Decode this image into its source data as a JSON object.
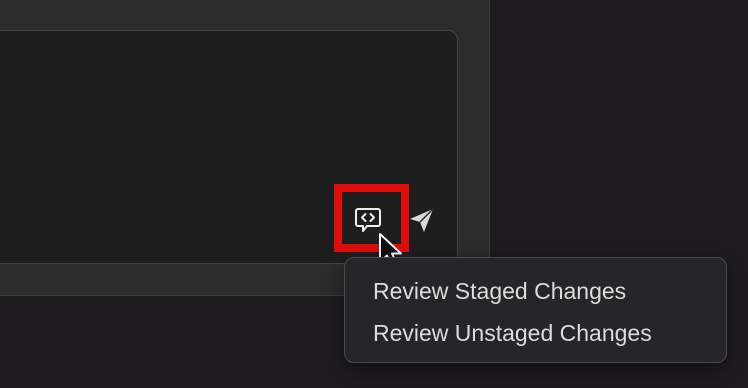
{
  "toolbar": {
    "review_icon": "code-review-icon",
    "send_icon": "send-icon"
  },
  "menu": {
    "items": [
      {
        "label": "Review Staged Changes"
      },
      {
        "label": "Review Unstaged Changes"
      }
    ]
  },
  "colors": {
    "highlight": "#e10d0d",
    "panel_bg": "#2c2c2c",
    "input_bg": "#1e1e1e",
    "menu_bg": "#262528",
    "menu_text": "#dcdcdc"
  }
}
